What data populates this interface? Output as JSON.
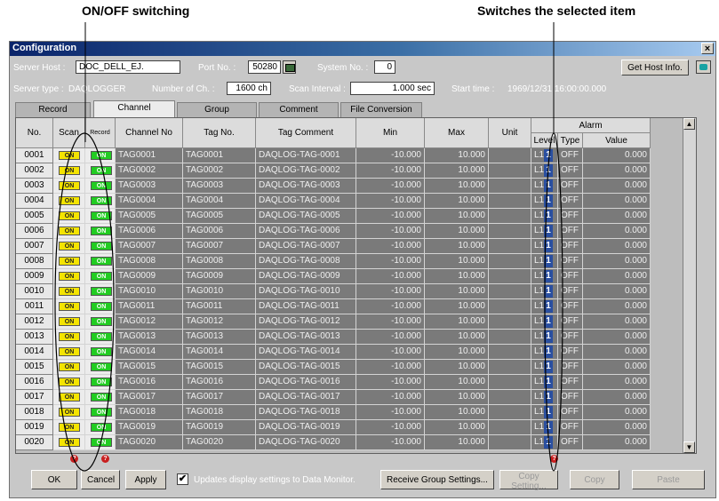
{
  "annotations": {
    "left_label": "ON/OFF switching",
    "right_label": "Switches the selected item"
  },
  "window": {
    "title": "Configuration",
    "close_glyph": "×",
    "server_host_label": "Server Host :",
    "server_host_value": "DOC_DELL_EJ.",
    "port_label": "Port No. :",
    "port_value": "50280",
    "system_label": "System No. :",
    "system_value": "0",
    "get_host_info": "Get Host Info.",
    "server_type_label": "Server type :",
    "server_type_value": "DAQLOGGER",
    "num_ch_label": "Number of Ch. :",
    "num_ch_value": "1600 ch",
    "scan_interval_label": "Scan Interval :",
    "scan_interval_value": "1.000 sec",
    "start_time_label": "Start time :",
    "start_time_value": "1969/12/31 16:00:00.000"
  },
  "tabs": [
    "Record",
    "Channel",
    "Group",
    "Comment",
    "File Conversion"
  ],
  "active_tab": "Channel",
  "columns": {
    "no": "No.",
    "scan": "Scan",
    "record": "Record",
    "channel_no": "Channel No",
    "tag_no": "Tag No.",
    "tag_comment": "Tag Comment",
    "min": "Min",
    "max": "Max",
    "unit": "Unit",
    "alarm": "Alarm",
    "level": "Level",
    "type": "Type",
    "value": "Value"
  },
  "switch_text": "ON",
  "level_icon_text": "1",
  "rows": [
    {
      "no": "0001",
      "channel": "TAG0001",
      "tag": "TAG0001",
      "comment": "DAQLOG-TAG-0001",
      "min": "-10.000",
      "max": "10.000",
      "unit": "",
      "level": "L1",
      "type": "OFF",
      "value": "0.000"
    },
    {
      "no": "0002",
      "channel": "TAG0002",
      "tag": "TAG0002",
      "comment": "DAQLOG-TAG-0002",
      "min": "-10.000",
      "max": "10.000",
      "unit": "",
      "level": "L1",
      "type": "OFF",
      "value": "0.000"
    },
    {
      "no": "0003",
      "channel": "TAG0003",
      "tag": "TAG0003",
      "comment": "DAQLOG-TAG-0003",
      "min": "-10.000",
      "max": "10.000",
      "unit": "",
      "level": "L1",
      "type": "OFF",
      "value": "0.000"
    },
    {
      "no": "0004",
      "channel": "TAG0004",
      "tag": "TAG0004",
      "comment": "DAQLOG-TAG-0004",
      "min": "-10.000",
      "max": "10.000",
      "unit": "",
      "level": "L1",
      "type": "OFF",
      "value": "0.000"
    },
    {
      "no": "0005",
      "channel": "TAG0005",
      "tag": "TAG0005",
      "comment": "DAQLOG-TAG-0005",
      "min": "-10.000",
      "max": "10.000",
      "unit": "",
      "level": "L1",
      "type": "OFF",
      "value": "0.000"
    },
    {
      "no": "0006",
      "channel": "TAG0006",
      "tag": "TAG0006",
      "comment": "DAQLOG-TAG-0006",
      "min": "-10.000",
      "max": "10.000",
      "unit": "",
      "level": "L1",
      "type": "OFF",
      "value": "0.000"
    },
    {
      "no": "0007",
      "channel": "TAG0007",
      "tag": "TAG0007",
      "comment": "DAQLOG-TAG-0007",
      "min": "-10.000",
      "max": "10.000",
      "unit": "",
      "level": "L1",
      "type": "OFF",
      "value": "0.000"
    },
    {
      "no": "0008",
      "channel": "TAG0008",
      "tag": "TAG0008",
      "comment": "DAQLOG-TAG-0008",
      "min": "-10.000",
      "max": "10.000",
      "unit": "",
      "level": "L1",
      "type": "OFF",
      "value": "0.000"
    },
    {
      "no": "0009",
      "channel": "TAG0009",
      "tag": "TAG0009",
      "comment": "DAQLOG-TAG-0009",
      "min": "-10.000",
      "max": "10.000",
      "unit": "",
      "level": "L1",
      "type": "OFF",
      "value": "0.000"
    },
    {
      "no": "0010",
      "channel": "TAG0010",
      "tag": "TAG0010",
      "comment": "DAQLOG-TAG-0010",
      "min": "-10.000",
      "max": "10.000",
      "unit": "",
      "level": "L1",
      "type": "OFF",
      "value": "0.000"
    },
    {
      "no": "0011",
      "channel": "TAG0011",
      "tag": "TAG0011",
      "comment": "DAQLOG-TAG-0011",
      "min": "-10.000",
      "max": "10.000",
      "unit": "",
      "level": "L1",
      "type": "OFF",
      "value": "0.000"
    },
    {
      "no": "0012",
      "channel": "TAG0012",
      "tag": "TAG0012",
      "comment": "DAQLOG-TAG-0012",
      "min": "-10.000",
      "max": "10.000",
      "unit": "",
      "level": "L1",
      "type": "OFF",
      "value": "0.000"
    },
    {
      "no": "0013",
      "channel": "TAG0013",
      "tag": "TAG0013",
      "comment": "DAQLOG-TAG-0013",
      "min": "-10.000",
      "max": "10.000",
      "unit": "",
      "level": "L1",
      "type": "OFF",
      "value": "0.000"
    },
    {
      "no": "0014",
      "channel": "TAG0014",
      "tag": "TAG0014",
      "comment": "DAQLOG-TAG-0014",
      "min": "-10.000",
      "max": "10.000",
      "unit": "",
      "level": "L1",
      "type": "OFF",
      "value": "0.000"
    },
    {
      "no": "0015",
      "channel": "TAG0015",
      "tag": "TAG0015",
      "comment": "DAQLOG-TAG-0015",
      "min": "-10.000",
      "max": "10.000",
      "unit": "",
      "level": "L1",
      "type": "OFF",
      "value": "0.000"
    },
    {
      "no": "0016",
      "channel": "TAG0016",
      "tag": "TAG0016",
      "comment": "DAQLOG-TAG-0016",
      "min": "-10.000",
      "max": "10.000",
      "unit": "",
      "level": "L1",
      "type": "OFF",
      "value": "0.000"
    },
    {
      "no": "0017",
      "channel": "TAG0017",
      "tag": "TAG0017",
      "comment": "DAQLOG-TAG-0017",
      "min": "-10.000",
      "max": "10.000",
      "unit": "",
      "level": "L1",
      "type": "OFF",
      "value": "0.000"
    },
    {
      "no": "0018",
      "channel": "TAG0018",
      "tag": "TAG0018",
      "comment": "DAQLOG-TAG-0018",
      "min": "-10.000",
      "max": "10.000",
      "unit": "",
      "level": "L1",
      "type": "OFF",
      "value": "0.000"
    },
    {
      "no": "0019",
      "channel": "TAG0019",
      "tag": "TAG0019",
      "comment": "DAQLOG-TAG-0019",
      "min": "-10.000",
      "max": "10.000",
      "unit": "",
      "level": "L1",
      "type": "OFF",
      "value": "0.000"
    },
    {
      "no": "0020",
      "channel": "TAG0020",
      "tag": "TAG0020",
      "comment": "DAQLOG-TAG-0020",
      "min": "-10.000",
      "max": "10.000",
      "unit": "",
      "level": "L1",
      "type": "OFF",
      "value": "0.000"
    }
  ],
  "footer": {
    "ok": "OK",
    "cancel": "Cancel",
    "apply": "Apply",
    "updates_label": "Updates display settings to Data Monitor.",
    "updates_checked": true,
    "receive_group": "Receive Group Settings...",
    "copy_setting": "Copy Setting...",
    "copy": "Copy",
    "paste": "Paste"
  },
  "colors": {
    "title_bar": "#0a246a",
    "scan_on": "#f4e400",
    "record_on": "#22cc22",
    "level_icon": "#2a4fa0",
    "cell_bg": "#7a7a7a"
  },
  "icons": [
    "host-browse-icon",
    "connect-icon",
    "close-icon",
    "level-select-icon",
    "scroll-up-icon",
    "scroll-down-icon",
    "info-badge-icon"
  ]
}
